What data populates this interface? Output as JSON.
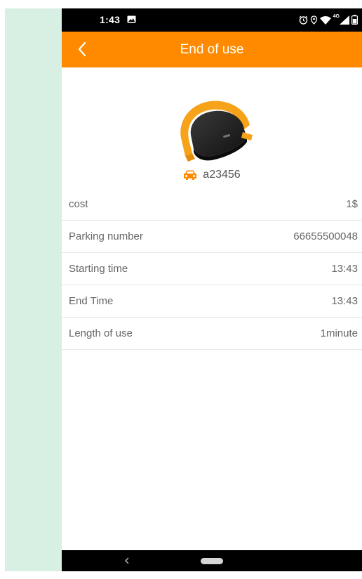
{
  "status_bar": {
    "time": "1:43",
    "network_label": "4G",
    "icons": [
      "image-icon",
      "alarm-icon",
      "location-icon",
      "wifi-icon",
      "signal-icon",
      "battery-icon"
    ]
  },
  "app_bar": {
    "title": "End of use",
    "back_icon": "chevron-left-icon",
    "color": "#ff8a00"
  },
  "device": {
    "image": "parking-lock-device-image",
    "plate_icon": "car-icon",
    "plate_number": "a23456"
  },
  "details": [
    {
      "label": "cost",
      "value": "1$"
    },
    {
      "label": "Parking number",
      "value": "66655500048"
    },
    {
      "label": "Starting time",
      "value": "13:43"
    },
    {
      "label": "End Time",
      "value": "13:43"
    },
    {
      "label": "Length of use",
      "value": "1minute"
    }
  ],
  "nav_bar": {
    "back_icon": "nav-back-icon",
    "home_icon": "home-pill-icon"
  },
  "colors": {
    "accent": "#ff8a00",
    "side_strip": "#d8efe3",
    "text": "#666666"
  }
}
